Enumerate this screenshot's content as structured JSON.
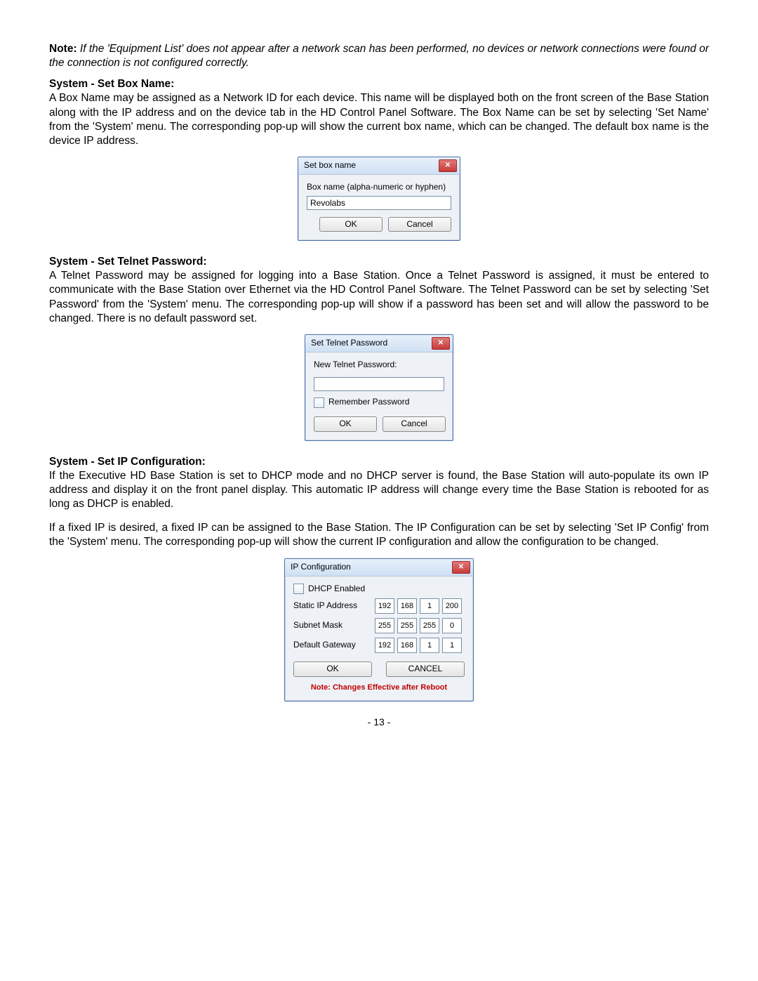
{
  "intro_note": {
    "label": "Note:",
    "text": "If the 'Equipment List' does not appear after a network scan has been performed, no devices or network connections were found or the connection is not configured correctly."
  },
  "sec1": {
    "heading": "System - Set Box Name:",
    "para": "A Box Name may be assigned as a Network ID for each device. This name will be displayed both on the front screen of the Base Station along with the IP address and on the device tab in the HD Control Panel Software. The Box Name can be set by selecting 'Set Name' from the 'System' menu. The corresponding pop-up will show the current box name, which can be changed. The default box name is the device IP address."
  },
  "dlg1": {
    "title": "Set box name",
    "field_label": "Box name   (alpha-numeric or hyphen)",
    "value": "Revolabs",
    "ok": "OK",
    "cancel": "Cancel"
  },
  "sec2": {
    "heading": "System - Set Telnet Password:",
    "para": "A Telnet Password may be assigned for logging into a Base Station. Once a Telnet Password is assigned, it must be entered to communicate with the Base Station over Ethernet via the HD Control Panel Software. The Telnet Password can be set by selecting 'Set Password' from the 'System' menu. The corresponding pop-up will show if a password has been set and will allow the password to be changed. There is no default password set."
  },
  "dlg2": {
    "title": "Set Telnet Password",
    "field_label": "New Telnet Password:",
    "value": "",
    "remember": "Remember Password",
    "ok": "OK",
    "cancel": "Cancel"
  },
  "sec3": {
    "heading": "System - Set IP Configuration:",
    "para1": "If the Executive HD Base Station is set to DHCP mode and no DHCP server is found, the Base Station will auto-populate its own IP address and display it on the front panel display. This automatic IP address will change every time the Base Station is rebooted for as long as DHCP is enabled.",
    "para2": "If a fixed IP is desired, a fixed IP can be assigned to the Base Station. The IP Configuration can be set by selecting 'Set IP Config' from the 'System' menu. The corresponding pop-up will show the current IP configuration and allow the configuration to be changed."
  },
  "dlg3": {
    "title": "IP Configuration",
    "dhcp": "DHCP Enabled",
    "static_label": "Static IP Address",
    "static_ip": [
      "192",
      "168",
      "1",
      "200"
    ],
    "subnet_label": "Subnet Mask",
    "subnet": [
      "255",
      "255",
      "255",
      "0"
    ],
    "gateway_label": "Default Gateway",
    "gateway": [
      "192",
      "168",
      "1",
      "1"
    ],
    "ok": "OK",
    "cancel": "CANCEL",
    "note": "Note: Changes Effective after Reboot"
  },
  "page_number": "- 13 -"
}
